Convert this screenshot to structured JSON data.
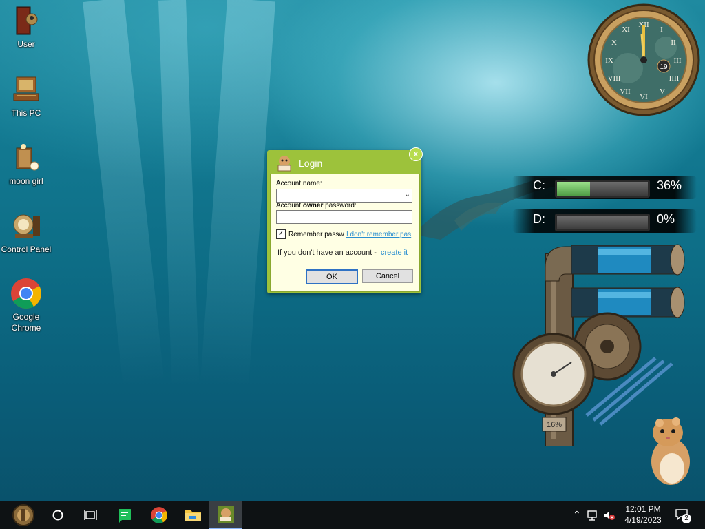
{
  "desktop_icons": [
    {
      "label": "User",
      "icon": "user-folder-icon"
    },
    {
      "label": "This PC",
      "icon": "this-pc-icon"
    },
    {
      "label": "moon girl",
      "icon": "moon-girl-icon"
    },
    {
      "label": "Control Panel",
      "icon": "control-panel-icon"
    },
    {
      "label": "Google Chrome",
      "icon": "chrome-icon"
    }
  ],
  "clock": {
    "numerals": [
      "XII",
      "I",
      "II",
      "III",
      "IIII",
      "V",
      "VI",
      "VII",
      "VIII",
      "IX",
      "X",
      "XI"
    ],
    "date": "19"
  },
  "drives": [
    {
      "label": "C:",
      "percent": 36,
      "percent_text": "36%"
    },
    {
      "label": "D:",
      "percent": 0,
      "percent_text": "0%"
    }
  ],
  "cpu_gauge": {
    "percent_text": "16%"
  },
  "login_dialog": {
    "title": "Login",
    "close": "x",
    "account_name_label": "Account name:",
    "account_name_value": "",
    "password_label_pre": "Account ",
    "password_label_bold": "owner",
    "password_label_post": " password:",
    "remember_label": "Remember passw",
    "remember_checked": true,
    "forgot_link": "I don't remember pas",
    "no_account_text": "If you don't have an account - ",
    "create_link": "create it",
    "ok_label": "OK",
    "cancel_label": "Cancel"
  },
  "taskbar": {
    "items": [
      "start-gear-icon",
      "cortana-circle-icon",
      "task-view-icon",
      "green-app-icon",
      "chrome-icon",
      "file-explorer-icon",
      "login-app-icon"
    ],
    "time": "12:01 PM",
    "date": "4/19/2023",
    "notification_count": "2"
  },
  "colors": {
    "dialog_border": "#9dc23b",
    "dialog_bg": "#ffffe4",
    "link": "#2b8fd0"
  }
}
